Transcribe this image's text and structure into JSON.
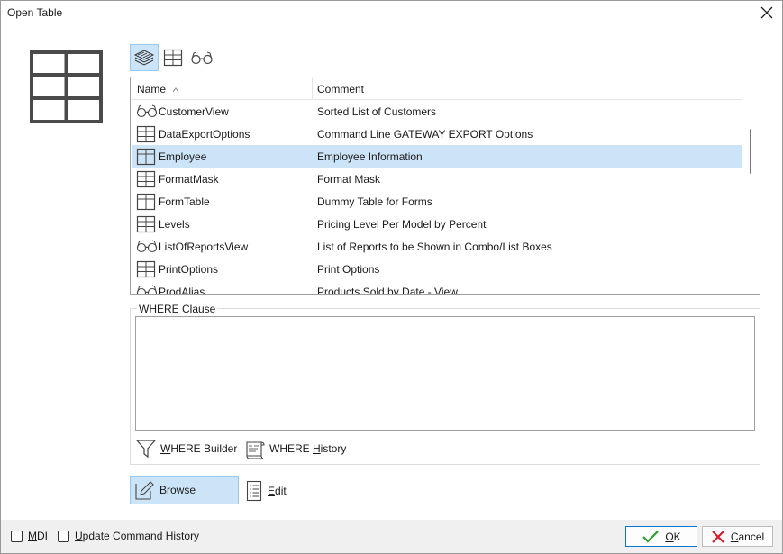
{
  "window": {
    "title": "Open Table"
  },
  "toolbar": {
    "icons": [
      "layers-icon",
      "table-icon",
      "glasses-icon"
    ],
    "active": "layers-icon"
  },
  "grid": {
    "columns": [
      "Name",
      "Comment"
    ],
    "sort_column": "Name",
    "rows": [
      {
        "icon": "view",
        "name": "CustomerView",
        "comment": "Sorted List of Customers",
        "selected": false
      },
      {
        "icon": "table",
        "name": "DataExportOptions",
        "comment": "Command Line GATEWAY EXPORT Options",
        "selected": false
      },
      {
        "icon": "table",
        "name": "Employee",
        "comment": "Employee Information",
        "selected": true
      },
      {
        "icon": "table",
        "name": "FormatMask",
        "comment": "Format Mask",
        "selected": false
      },
      {
        "icon": "table",
        "name": "FormTable",
        "comment": "Dummy Table for Forms",
        "selected": false
      },
      {
        "icon": "table",
        "name": "Levels",
        "comment": "Pricing Level Per Model by Percent",
        "selected": false
      },
      {
        "icon": "view",
        "name": "ListOfReportsView",
        "comment": "List of Reports to be Shown in Combo/List Boxes",
        "selected": false
      },
      {
        "icon": "table",
        "name": "PrintOptions",
        "comment": "Print Options",
        "selected": false
      },
      {
        "icon": "view",
        "name": "ProdAlias",
        "comment": "Products Sold by Date - View",
        "selected": false
      }
    ]
  },
  "where": {
    "group_label": "WHERE Clause",
    "value": "",
    "builder_label": "WHERE Builder",
    "history_label": "WHERE History"
  },
  "actions": {
    "browse_label": "Browse",
    "edit_label": "Edit"
  },
  "footer": {
    "mdi_label": "MDI",
    "update_history_label": "Update Command History",
    "ok_label": "OK",
    "cancel_label": "Cancel"
  },
  "colors": {
    "selection": "#cce4f7",
    "accent": "#0078d4",
    "ok_check": "#2ca02c",
    "cancel_x": "#e81123"
  }
}
